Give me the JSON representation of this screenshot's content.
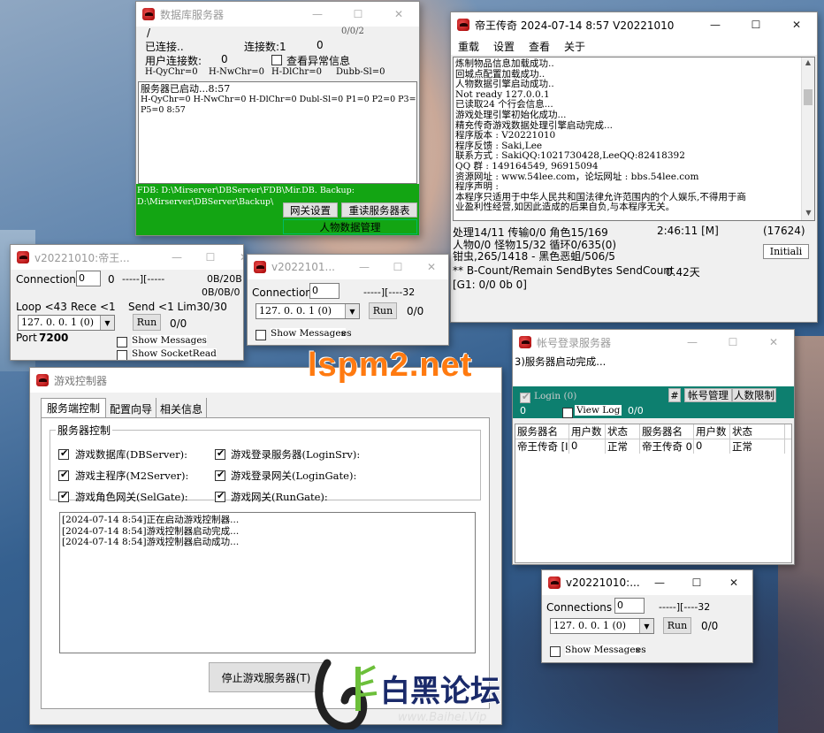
{
  "colors": {
    "green_panel": "#13a513",
    "teal_panel": "#0d7f6f",
    "watermark": "#ff7a10"
  },
  "db_server": {
    "title": "数据库服务器",
    "status_slash": "/",
    "counter": "0/0/2",
    "connected": "已连接..",
    "conn_count_label": "连接数:1",
    "conn_count_val": "0",
    "user_conn_label": "用户连接数:",
    "user_conn_val": "0",
    "show_errors": "查看异常信息",
    "stats": [
      "H-QyChr=0",
      "H-NwChr=0",
      "H-DlChr=0",
      "Dubb-Sl=0"
    ],
    "log": [
      "服务器已启动...8:57",
      "H-QyChr=0 H-NwChr=0 H-DlChr=0 Dubl-Sl=0 P1=0 P2=0 P3=0 P4=0",
      "P5=0 8:57"
    ],
    "path1": "FDB: D:\\Mirserver\\DBServer\\FDB\\Mir.DB. Backup:",
    "path2": "D:\\Mirserver\\DBServer\\Backup\\",
    "btn_gateway": "网关设置",
    "btn_reload": "重读服务器表",
    "btn_char_mgr": "人物数据管理"
  },
  "m2": {
    "title": "帝王传奇 2024-07-14 8:57 V20221010",
    "menu": [
      "重载",
      "设置",
      "查看",
      "关于"
    ],
    "log": [
      "炼制物品信息加载成功..",
      "回城点配置加载成功..",
      "人物数据引擎启动成功..",
      "Not ready 127.0.0.1",
      "已读取24 个行会信息...",
      "游戏处理引擎初始化成功...",
      "精充传奇游戏数据处理引擎启动完成...",
      "程序版本 : V20221010",
      "程序反馈 : Saki,Lee",
      "联系方式 : SakiQQ:1021730428,LeeQQ:82418392",
      "QQ   群 : 149164549, 96915094",
      "资源网址 : www.54lee.com，论坛网址 : bbs.54lee.com",
      "程序声明 :",
      "本程序只适用于中华人民共和国法律允许范围内的个人娱乐,不得用于商",
      "业盈利性经营,如因此造成的后果自负,与本程序无关。"
    ],
    "stat1": "处理14/11 传输0/0 角色15/169",
    "time": "2:46:11 [M]",
    "count": "(17624)",
    "stat2": "人物0/0 怪物15/32 循环0/635(0)",
    "stat3": "钳虫,265/1418 - 黑色恶蛆/506/5",
    "init_btn": "Initiali",
    "stat4": "** B-Count/Remain SendBytes SendCount",
    "days": "0.42天",
    "stat5": "[G1: 0/0 0b 0]"
  },
  "gate1": {
    "title": "v20221010:帝王...",
    "conn_label": "Connection",
    "conn_val": "0",
    "conn_num": "0",
    "dashes": "-----][-----",
    "bytes1": "0B/20B",
    "bytes2": "0B/0B/0",
    "loop": "Loop <43",
    "rece": "Rece <1",
    "send": "Send <1 Lim30/30",
    "ip": "127. 0. 0. 1  (0)",
    "run": "Run",
    "ratio": "0/0",
    "port_label": "Port",
    "port_val": "7200",
    "show_msgs": "Show Messages",
    "show_socket": "Show SocketRead"
  },
  "gate2": {
    "title": "v2022101...",
    "conn_label": "Connection",
    "conn_val": "0",
    "dashes": "-----][----32",
    "ip": "127. 0. 0. 1  (0)",
    "run": "Run",
    "ratio": "0/0",
    "show_msgs": "Show Messages",
    "tail": "es"
  },
  "login_srv": {
    "title": "帐号登录服务器",
    "log": "3)服务器启动完成...",
    "login_chk": "Login (0)",
    "login_val": "0",
    "view_log": "View Log",
    "view_val": "0/0",
    "hash_btn": "#",
    "btn_acct": "帐号管理",
    "btn_limit": "人数限制",
    "headers": [
      "服务器名",
      "用户数",
      "状态",
      "服务器名",
      "用户数",
      "状态"
    ],
    "row": [
      "帝王传奇 [I",
      "0",
      "正常",
      "帝王传奇 0",
      "0",
      "正常"
    ]
  },
  "controller": {
    "title": "游戏控制器",
    "tabs": [
      "服务端控制",
      "配置向导",
      "相关信息"
    ],
    "group": "服务器控制",
    "checks_left": [
      "游戏数据库(DBServer):",
      "游戏主程序(M2Server):",
      "游戏角色网关(SelGate):"
    ],
    "checks_right": [
      "游戏登录服务器(LoginSrv):",
      "游戏登录网关(LoginGate):",
      "游戏网关(RunGate):"
    ],
    "log": [
      "[2024-07-14 8:54]正在启动游戏控制器...",
      "[2024-07-14 8:54]游戏控制器启动完成...",
      "[2024-07-14 8:54]游戏控制器启动成功..."
    ],
    "stop_btn": "停止游戏服务器(T)"
  },
  "gate3": {
    "title": "v20221010:...",
    "conn_label": "Connections",
    "conn_val": "0",
    "dashes": "-----][----32",
    "ip": "127. 0. 0. 1  (0)",
    "run": "Run",
    "ratio": "0/0",
    "show_msgs": "Show Messages",
    "tail": "es"
  },
  "watermark": {
    "text": "lspm2.net",
    "logo_text": "白黑论坛",
    "logo_url": "www.Baihei.Vip"
  }
}
